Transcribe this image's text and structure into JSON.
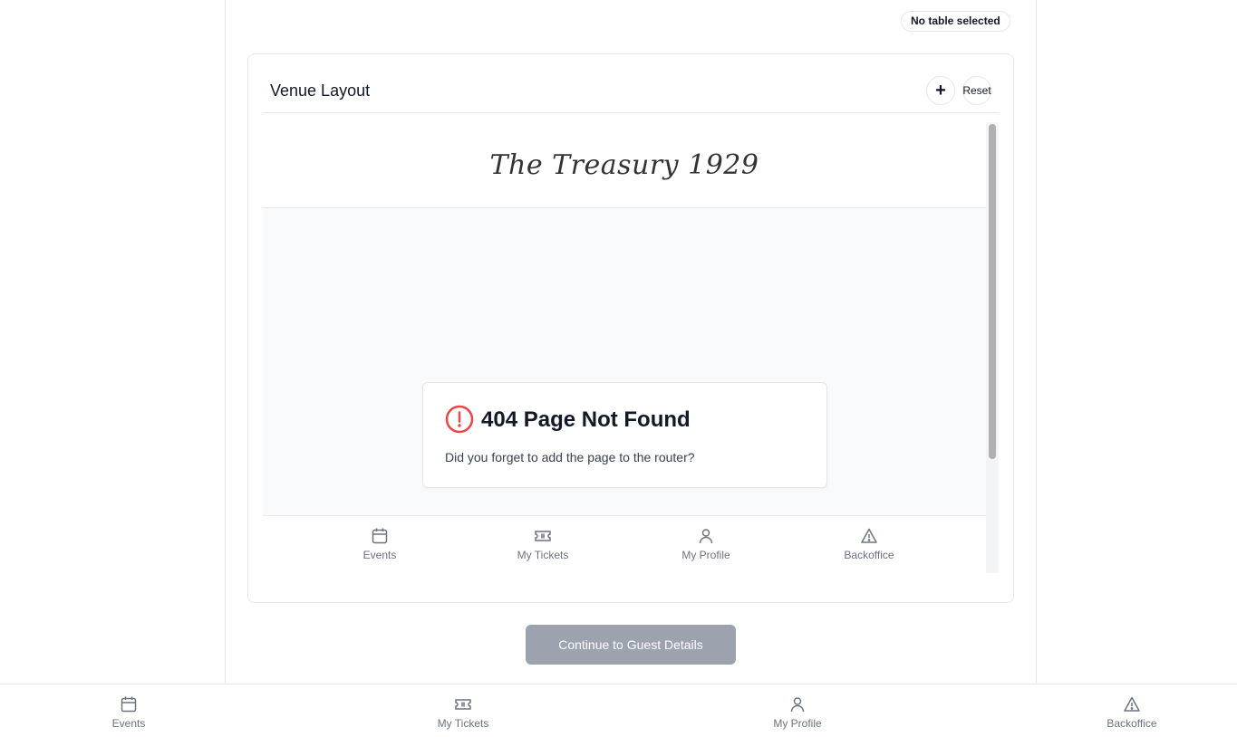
{
  "status_badge": "No table selected",
  "venue_card": {
    "title": "Venue Layout",
    "zoom_in_label": "+",
    "reset_label": "Reset"
  },
  "embedded_frame": {
    "logo_text": "The Treasury 1929",
    "error": {
      "title": "404 Page Not Found",
      "message": "Did you forget to add the page to the router?",
      "icon": "alert-circle-icon",
      "icon_color": "#ef4444"
    },
    "nav": [
      {
        "label": "Events",
        "icon": "calendar-icon"
      },
      {
        "label": "My Tickets",
        "icon": "ticket-icon"
      },
      {
        "label": "My Profile",
        "icon": "user-icon"
      },
      {
        "label": "Backoffice",
        "icon": "alert-triangle-icon"
      }
    ]
  },
  "continue_button": {
    "label": "Continue to Guest Details",
    "color": "#9ca3af"
  },
  "bottom_nav": [
    {
      "label": "Events",
      "icon": "calendar-icon"
    },
    {
      "label": "My Tickets",
      "icon": "ticket-icon"
    },
    {
      "label": "My Profile",
      "icon": "user-icon"
    },
    {
      "label": "Backoffice",
      "icon": "alert-triangle-icon"
    }
  ]
}
